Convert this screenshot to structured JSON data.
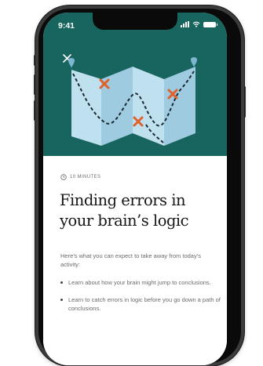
{
  "status_bar": {
    "time": "9:41"
  },
  "header": {
    "close_icon": "close-icon",
    "illustration": "folded-map-with-errors"
  },
  "colors": {
    "hero_background": "#17655e",
    "map_panel_light": "#bfe0ee",
    "map_panel_dark": "#9fcbe0",
    "map_pin": "#7fb6cf",
    "error_mark": "#e0612b"
  },
  "lesson": {
    "duration": "10 MINUTES",
    "title": "Finding errors in your brain’s logic",
    "intro": "Here’s what you can expect to take away from today’s activity:",
    "bullets": [
      "Learn about how your brain might jump to conclusions.",
      "Learn to catch errors in logic before you go down a path of conclusions."
    ]
  }
}
